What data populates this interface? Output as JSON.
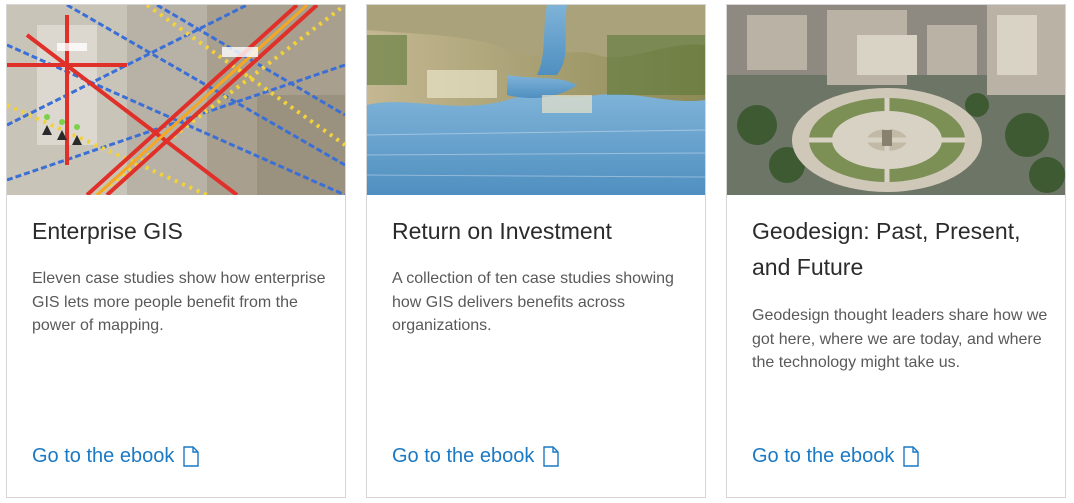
{
  "cards": [
    {
      "title": "Enterprise GIS",
      "description": "Eleven case studies show how enterprise GIS lets more people benefit from the power of mapping.",
      "link_label": "Go to the ebook",
      "link_icon": "document-icon",
      "image_alt": "aerial-map-with-utility-lines"
    },
    {
      "title": "Return on Investment",
      "description": "A collection of ten case studies showing how GIS delivers benefits across organizations.",
      "link_label": "Go to the ebook",
      "link_icon": "document-icon",
      "image_alt": "3d-terrain-bay-illustration"
    },
    {
      "title": "Geodesign: Past, Present, and Future",
      "description": "Geodesign thought leaders share how we got here, where we are today, and where the technology might take us.",
      "link_label": "Go to the ebook",
      "link_icon": "document-icon",
      "image_alt": "3d-city-plaza-rendering"
    }
  ],
  "colors": {
    "link": "#1b79c4",
    "title": "#2b2b2b",
    "body": "#595959",
    "card_border": "#d6d6d6"
  }
}
